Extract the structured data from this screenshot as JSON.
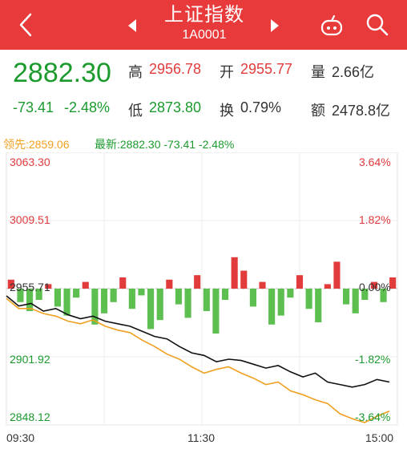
{
  "header": {
    "title": "上证指数",
    "code": "1A0001",
    "colors": {
      "bar": "#e83a3a",
      "text": "#ffffff"
    }
  },
  "quote": {
    "price": "2882.30",
    "change": "-73.41",
    "change_pct": "-2.48%",
    "high_label": "高",
    "high": "2956.78",
    "open_label": "开",
    "open": "2955.77",
    "volume_label": "量",
    "volume": "2.66亿",
    "low_label": "低",
    "low": "2873.80",
    "turnover_label": "换",
    "turnover": "0.79%",
    "amount_label": "额",
    "amount": "2478.8亿"
  },
  "legend": {
    "lead": "领先:2859.06",
    "latest": "最新:2882.30 -73.41 -2.48%"
  },
  "chart_data": {
    "type": "line",
    "y_left_ticks": [
      "3063.30",
      "3009.51",
      "2955.71",
      "2901.92",
      "2848.12"
    ],
    "y_right_ticks": [
      "3.64%",
      "1.82%",
      "0.00%",
      "-1.82%",
      "-3.64%"
    ],
    "x_ticks": [
      "09:30",
      "11:30",
      "15:00"
    ],
    "ylim": [
      2848.12,
      3063.3
    ],
    "prev_close": 2955.71,
    "series": [
      {
        "name": "最新",
        "color": "#111111",
        "values": [
          2950,
          2942,
          2944,
          2938,
          2940,
          2935,
          2932,
          2934,
          2930,
          2928,
          2926,
          2922,
          2918,
          2916,
          2910,
          2905,
          2903,
          2898,
          2900,
          2899,
          2896,
          2893,
          2895,
          2890,
          2886,
          2889,
          2882,
          2880,
          2878,
          2880,
          2884,
          2882
        ]
      },
      {
        "name": "领先",
        "color": "#f0a020",
        "values": [
          2948,
          2940,
          2940,
          2936,
          2934,
          2930,
          2928,
          2931,
          2926,
          2923,
          2921,
          2915,
          2910,
          2904,
          2900,
          2894,
          2889,
          2892,
          2894,
          2889,
          2885,
          2880,
          2882,
          2875,
          2872,
          2868,
          2865,
          2857,
          2853,
          2850,
          2855,
          2859
        ]
      }
    ],
    "bar_values": [
      0.4,
      -0.6,
      -1.0,
      -0.5,
      0.2,
      -0.8,
      -1.2,
      -0.4,
      0.3,
      -1.6,
      -1.1,
      -0.6,
      0.5,
      -0.9,
      -0.3,
      -1.8,
      -1.4,
      0.4,
      -0.7,
      -1.3,
      0.6,
      -1.0,
      -2.0,
      -0.5,
      1.4,
      0.8,
      -0.8,
      0.3,
      -1.6,
      -1.2,
      -0.4,
      0.6,
      -0.9,
      -1.5,
      0.2,
      1.2,
      -0.7,
      -1.1,
      -0.5,
      0.3,
      -0.6,
      0.5
    ]
  },
  "icons": {
    "back": "chevron-left-icon",
    "prev": "triangle-left-icon",
    "next": "triangle-right-icon",
    "robot": "robot-icon",
    "search": "search-icon"
  }
}
